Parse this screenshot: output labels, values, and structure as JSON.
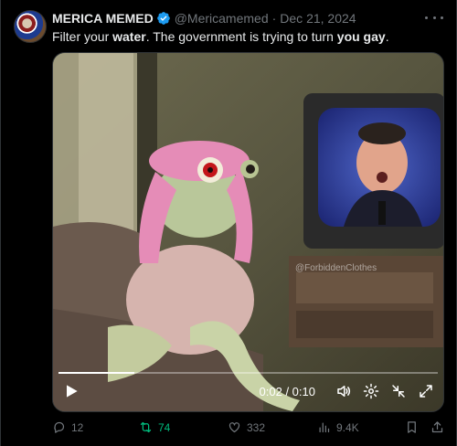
{
  "author": {
    "name": "MERICA MEMED",
    "handle": "@Mericamemed",
    "separator": "·",
    "date": "Dec 21, 2024"
  },
  "tweet": {
    "text_part1": "Filter your ",
    "text_bold1": "water",
    "text_part2": ". The government is trying to turn ",
    "text_bold2": "you gay",
    "text_part3": "."
  },
  "video": {
    "watermark": "@ForbiddenClothes",
    "time": "0:02 / 0:10",
    "progress": 0.2
  },
  "metrics": {
    "replies": "12",
    "reposts": "74",
    "likes": "332",
    "views": "9.4K"
  },
  "icons": [
    "verified-badge-icon",
    "more-icon",
    "play-icon",
    "volume-icon",
    "settings-icon",
    "fullscreen-exit-icon",
    "expand-icon",
    "reply-icon",
    "repost-icon",
    "like-icon",
    "views-icon",
    "bookmark-icon",
    "share-icon"
  ],
  "colors": {
    "background": "#000000",
    "text": "#e7e9ea",
    "muted": "#71767b",
    "verified": "#1d9bf0",
    "repost_active": "#00ba7c"
  }
}
